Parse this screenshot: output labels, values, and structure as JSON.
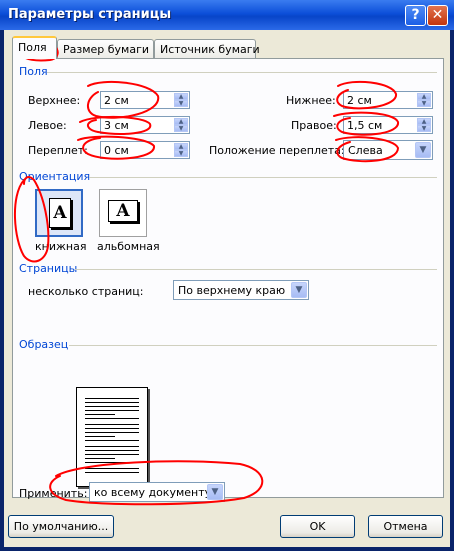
{
  "window": {
    "title": "Параметры страницы",
    "help_glyph": "?",
    "close_glyph": "✕"
  },
  "tabs": [
    {
      "label": "Поля",
      "active": true
    },
    {
      "label": "Размер бумаги"
    },
    {
      "label": "Источник бумаги"
    }
  ],
  "margins": {
    "group": "Поля",
    "top_label": "Верхнее:",
    "top_value": "2 см",
    "bottom_label": "Нижнее:",
    "bottom_value": "2 см",
    "left_label": "Левое:",
    "left_value": "3 см",
    "right_label": "Правое:",
    "right_value": "1,5 см",
    "gutter_label": "Переплет:",
    "gutter_value": "0 см",
    "gutter_pos_label": "Положение переплета:",
    "gutter_pos_value": "Слева"
  },
  "orientation": {
    "group": "Ориентация",
    "portrait_label": "книжная",
    "landscape_label": "альбомная",
    "icon_letter": "A",
    "selected": "portrait"
  },
  "pages": {
    "group": "Страницы",
    "multiple_label": "несколько страниц:",
    "multiple_value": "По верхнему краю"
  },
  "preview": {
    "group": "Образец"
  },
  "apply": {
    "label": "Применить:",
    "value": "ко всему документу"
  },
  "buttons": {
    "default": "По умолчанию...",
    "ok": "OK",
    "cancel": "Отмена"
  },
  "colors": {
    "accent": "#0046d5",
    "annotation": "#ff0000"
  }
}
